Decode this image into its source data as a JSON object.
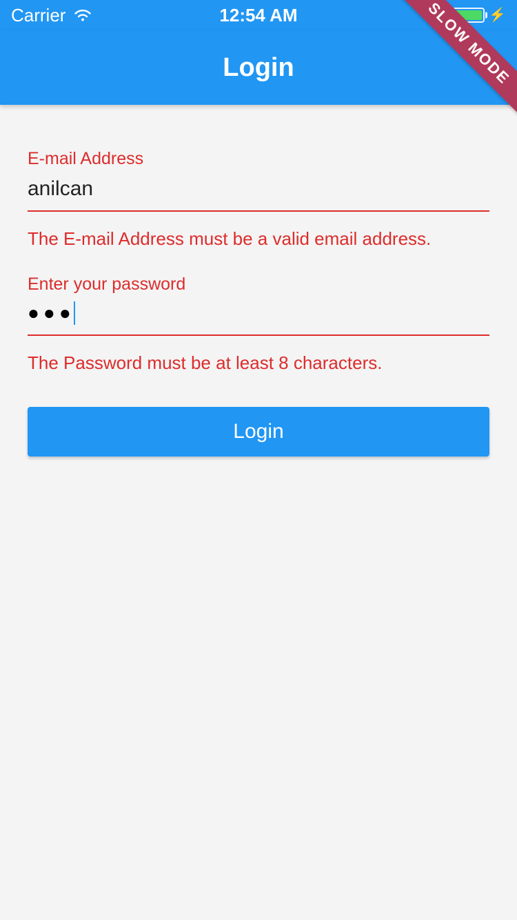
{
  "status_bar": {
    "carrier": "Carrier",
    "time": "12:54 AM"
  },
  "ribbon": {
    "label": "SLOW MODE"
  },
  "app_bar": {
    "title": "Login"
  },
  "form": {
    "email": {
      "label": "E-mail Address",
      "value": "anilcan",
      "error": "The E-mail Address must be a valid email address."
    },
    "password": {
      "label": "Enter your password",
      "masked_value": "●●●",
      "error": "The Password must be at least 8 characters."
    },
    "submit_label": "Login"
  },
  "colors": {
    "primary": "#2196f3",
    "error": "#dd2c2c",
    "ribbon": "#b03a5b",
    "battery_fill": "#4cd964"
  }
}
